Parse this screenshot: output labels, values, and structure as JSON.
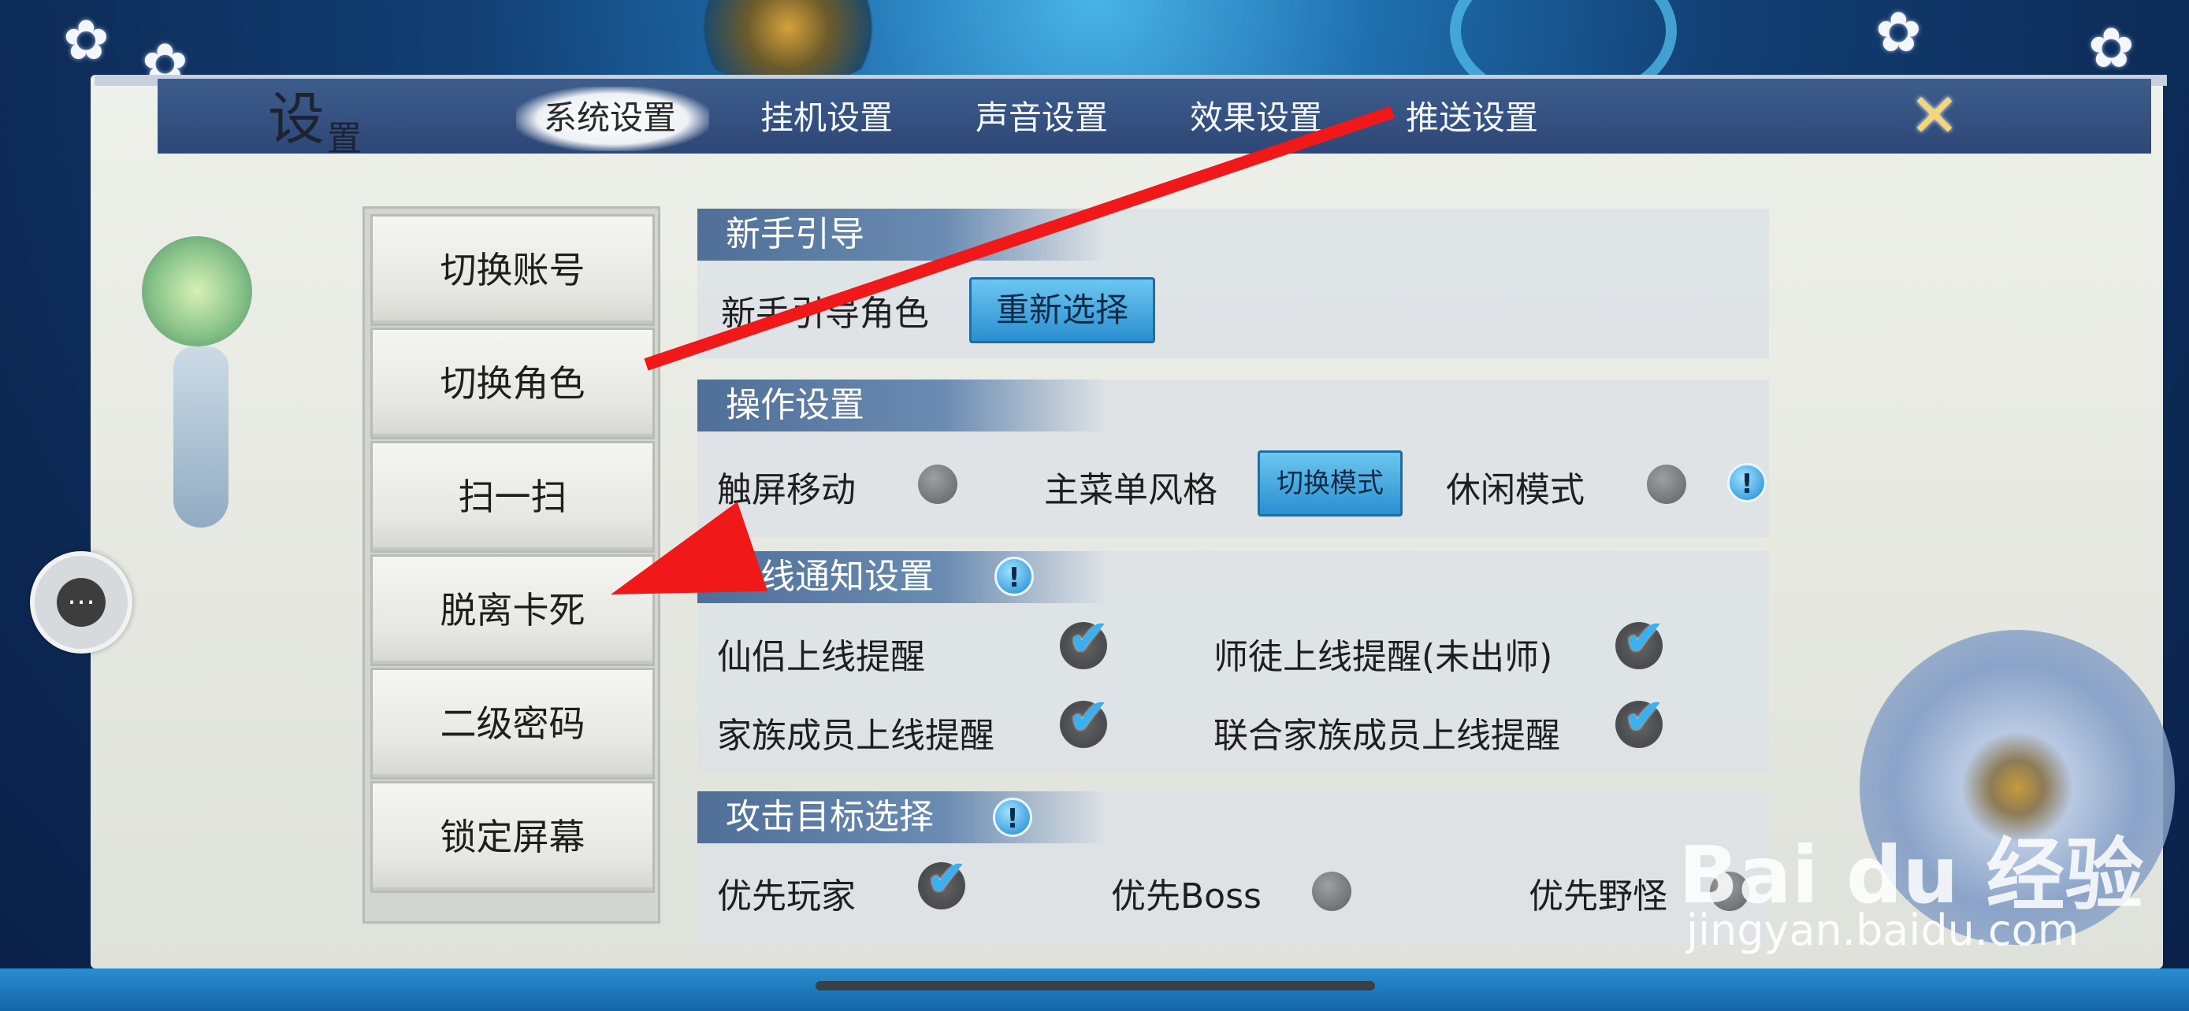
{
  "panel": {
    "title_1": "设",
    "title_2": "置"
  },
  "tabs": [
    {
      "label": "系统设置",
      "active": true
    },
    {
      "label": "挂机设置",
      "active": false
    },
    {
      "label": "声音设置",
      "active": false
    },
    {
      "label": "效果设置",
      "active": false
    },
    {
      "label": "推送设置",
      "active": false
    }
  ],
  "close_glyph": "✕",
  "chat_glyph": "⋯",
  "menu": [
    "切换账号",
    "切换角色",
    "扫一扫",
    "脱离卡死",
    "二级密码",
    "锁定屏幕"
  ],
  "sections": {
    "newbie": {
      "title": "新手引导",
      "label": "新手引导角色",
      "button": "重新选择"
    },
    "operation": {
      "title": "操作设置",
      "touch_move": "触屏移动",
      "menu_style": "主菜单风格",
      "switch_mode": "切换模式",
      "casual_mode": "休闲模式"
    },
    "online": {
      "title": "上线通知设置",
      "items": [
        "仙侣上线提醒",
        "师徒上线提醒(未出师)",
        "家族成员上线提醒",
        "联合家族成员上线提醒"
      ]
    },
    "target": {
      "title": "攻击目标选择",
      "items": [
        "优先玩家",
        "优先Boss",
        "优先野怪"
      ]
    }
  },
  "info_glyph": "!",
  "check_glyph": "✔",
  "watermark": {
    "brand": "Bai du 经验",
    "url": "jingyan.baidu.com"
  },
  "colors": {
    "arrow": "#f01818",
    "accent": "#2a8fd0",
    "header": "#2d4776"
  }
}
